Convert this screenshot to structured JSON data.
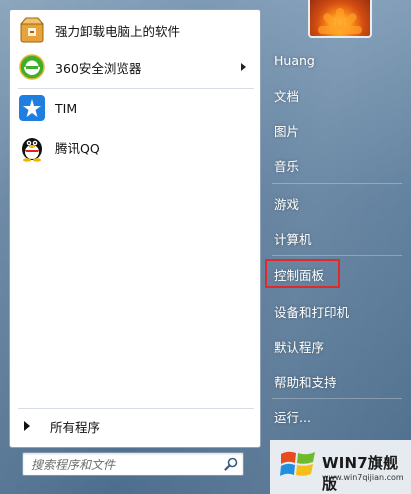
{
  "programs": [
    {
      "label": "强力卸载电脑上的软件",
      "icon": "uninstall-box-icon",
      "has_submenu": false
    },
    {
      "label": "360安全浏览器",
      "icon": "360-browser-icon",
      "has_submenu": true
    },
    {
      "label": "TIM",
      "icon": "tim-icon",
      "has_submenu": false
    },
    {
      "label": "腾讯QQ",
      "icon": "qq-penguin-icon",
      "has_submenu": false
    }
  ],
  "all_programs_label": "所有程序",
  "search": {
    "placeholder": "搜索程序和文件",
    "icon": "search-icon"
  },
  "right_menu": [
    {
      "label": "Huang"
    },
    {
      "label": "文档"
    },
    {
      "label": "图片"
    },
    {
      "label": "音乐"
    },
    {
      "label": "游戏"
    },
    {
      "label": "计算机"
    },
    {
      "label": "控制面板",
      "highlighted": true,
      "highlight_color": "#e02a2a"
    },
    {
      "label": "设备和打印机"
    },
    {
      "label": "默认程序"
    },
    {
      "label": "帮助和支持"
    },
    {
      "label": "运行..."
    }
  ],
  "watermark": {
    "title": "WIN7旗舰版",
    "url": "www.win7qijian.com"
  },
  "colors": {
    "frame": "#5f7f9d",
    "pane": "#ffffff",
    "highlight": "#e02a2a"
  }
}
